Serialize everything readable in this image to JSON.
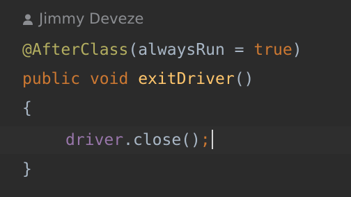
{
  "author_hint": {
    "icon": "user-icon",
    "name": "Jimmy Deveze"
  },
  "code": {
    "line1": {
      "annotation": "@AfterClass",
      "open_paren": "(",
      "param": "alwaysRun = ",
      "value": "true",
      "close_paren": ")"
    },
    "line2": {
      "kw_public": "public",
      "space1": " ",
      "kw_void": "void",
      "space2": " ",
      "method": "exitDriver",
      "parens": "()"
    },
    "line3": {
      "brace": "{"
    },
    "line4": {
      "field": "driver",
      "call": ".close()",
      "semicolon": ";"
    },
    "line5": {
      "brace": "}"
    }
  },
  "colors": {
    "background": "#2b2b2b",
    "annotation": "#b3ae60",
    "keyword": "#cc7832",
    "method": "#ffc66d",
    "field": "#9876aa",
    "plain": "#a9b7c6",
    "hint": "#8b8d91"
  }
}
